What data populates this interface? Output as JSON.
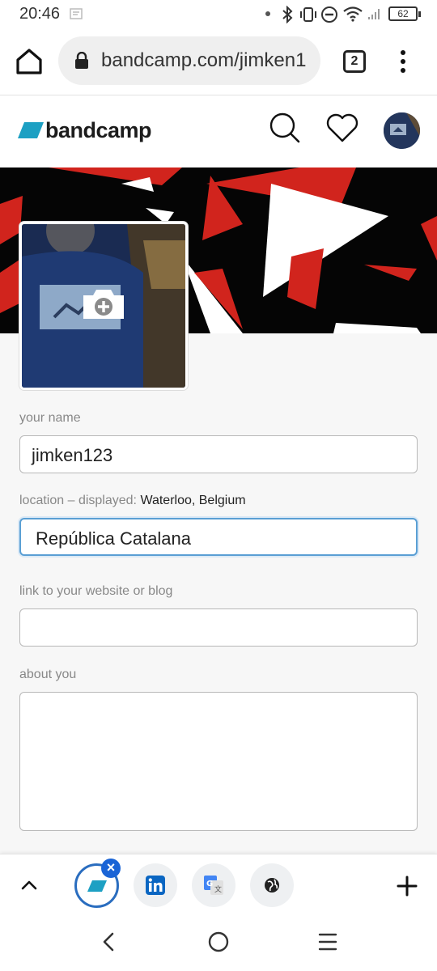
{
  "status_bar": {
    "time": "20:46",
    "battery": "62",
    "icons": [
      "notification-dot-icon",
      "bluetooth-icon",
      "vibrate-icon",
      "do-not-disturb-icon",
      "wifi-icon",
      "signal-icon",
      "battery-icon"
    ]
  },
  "browser": {
    "url": "bandcamp.com/jimken1",
    "tab_count": "2"
  },
  "site": {
    "logo_text": "bandcamp",
    "brand_color": "#1da0c3"
  },
  "form": {
    "name_label": "your name",
    "name_value": "jimken123",
    "location_label": "location – displayed:",
    "location_displayed": "Waterloo, Belgium",
    "location_value": "República Catalana",
    "website_label": "link to your website or blog",
    "website_value": "",
    "about_label": "about you",
    "about_value": ""
  },
  "tab_strip": {
    "tabs": [
      {
        "icon": "bandcamp-icon",
        "active": true
      },
      {
        "icon": "linkedin-icon",
        "active": false
      },
      {
        "icon": "google-translate-icon",
        "active": false
      },
      {
        "icon": "globe-icon",
        "active": false
      }
    ],
    "close_glyph": "×"
  },
  "colors": {
    "focus_border": "#5a9fd4",
    "banner_red": "#d1241d",
    "active_tab_ring": "#2a6dbf"
  }
}
